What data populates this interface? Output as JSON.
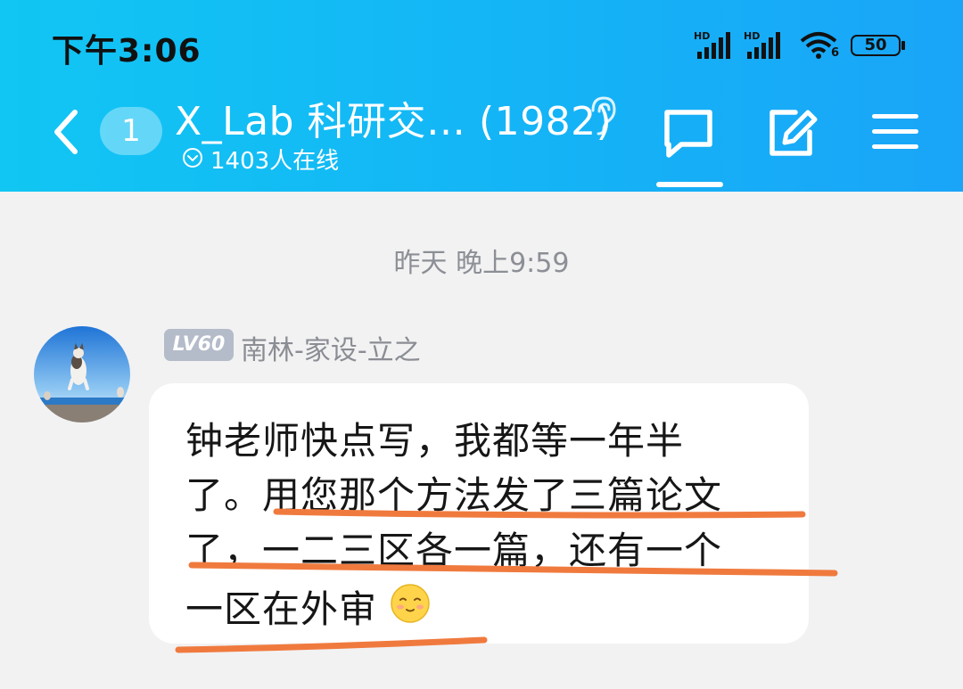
{
  "status_bar": {
    "time": "下午3:06",
    "signal_label_1": "HD",
    "signal_label_2": "HD",
    "wifi_label": "6",
    "battery": "50"
  },
  "header": {
    "unread_count": "1",
    "group_name": "X_Lab 科研交… (1982)",
    "online_count": "1403人在线",
    "icons": [
      "back-chevron-icon",
      "ear-icon",
      "chat-bubble-icon",
      "edit-post-icon",
      "menu-icon"
    ]
  },
  "chat": {
    "timestamp": "昨天 晚上9:59",
    "message": {
      "level": "LV60",
      "sender": "南林-家设-立之",
      "lines": [
        "钟老师快点写，我都等一年半",
        "了。用您那个方法发了三篇论文",
        "了，一二三区各一篇，还有一个",
        "一区在外审"
      ],
      "emoji": "smile-face-emoji"
    }
  },
  "colors": {
    "header_start": "#11c6f3",
    "header_end": "#1aa5f8",
    "annotation": "#f07a3e",
    "background": "#f2f2f3"
  }
}
